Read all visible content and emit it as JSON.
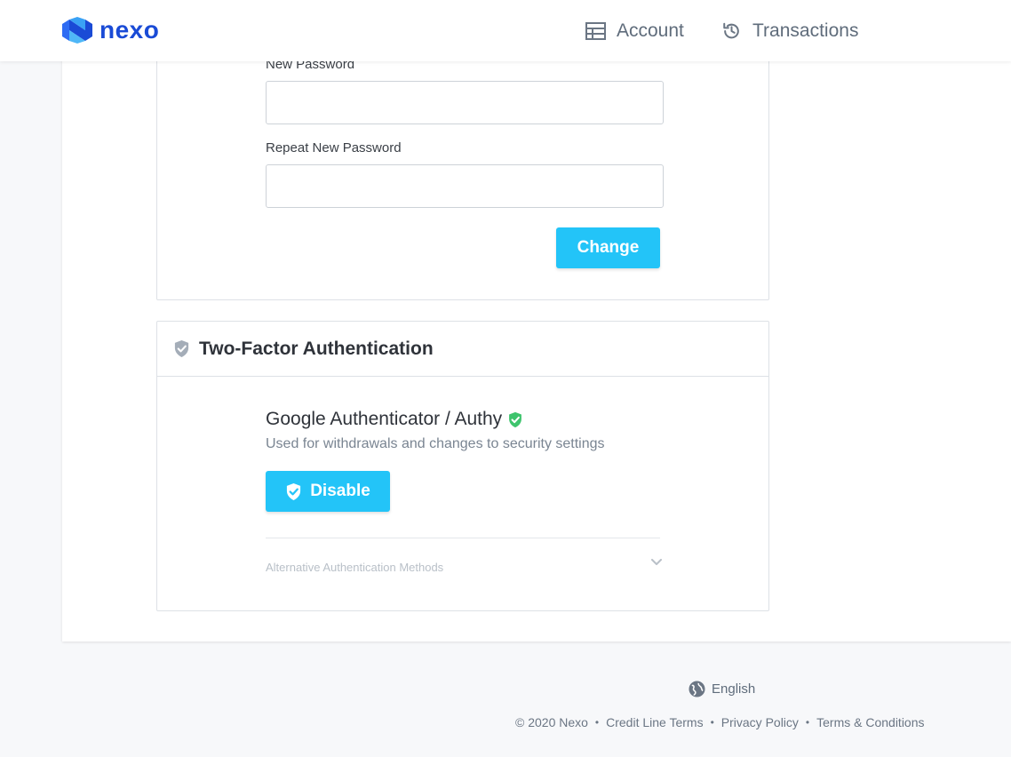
{
  "brand": {
    "name": "nexo",
    "primary_color": "#1a4bd6",
    "accent_color": "#23c4f8"
  },
  "nav": {
    "account_label": "Account",
    "account_icon": "table-icon",
    "transactions_label": "Transactions",
    "transactions_icon": "history-icon"
  },
  "password_section": {
    "new_password_label": "New Password",
    "repeat_password_label": "Repeat New Password",
    "new_password_value": "",
    "repeat_password_value": "",
    "change_button_label": "Change"
  },
  "tfa_section": {
    "title": "Two-Factor Authentication",
    "method_title": "Google Authenticator / Authy",
    "method_status": "enabled",
    "method_description": "Used for withdrawals and changes to security settings",
    "disable_button_label": "Disable",
    "alternative_methods_label": "Alternative Authentication Methods"
  },
  "footer": {
    "language": "English",
    "copyright": "© 2020 Nexo",
    "links": [
      "Credit Line Terms",
      "Privacy Policy",
      "Terms & Conditions"
    ]
  }
}
